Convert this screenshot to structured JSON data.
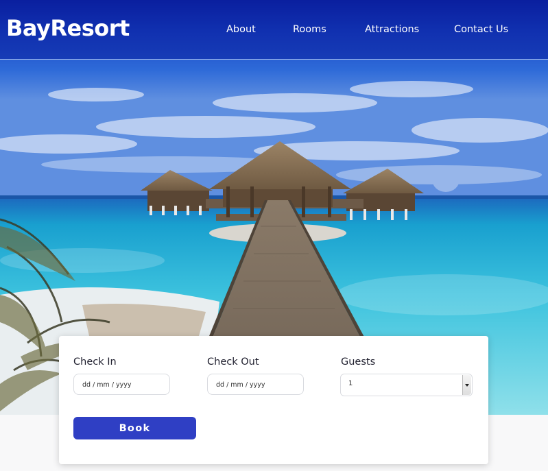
{
  "header": {
    "logo": "BayResort",
    "nav": [
      {
        "label": "About"
      },
      {
        "label": "Rooms"
      },
      {
        "label": "Attractions"
      },
      {
        "label": "Contact Us"
      }
    ]
  },
  "hero": {
    "image_description_icon": "tropical-overwater-bungalow-photo"
  },
  "booking": {
    "check_in": {
      "label": "Check In",
      "placeholder": "dd / mm / yyyy"
    },
    "check_out": {
      "label": "Check Out",
      "placeholder": "dd / mm / yyyy"
    },
    "guests": {
      "label": "Guests",
      "value": "1"
    },
    "book_label": "Book"
  },
  "colors": {
    "accent": "#2f3fc4",
    "header_blue": "#0a2aa8"
  }
}
